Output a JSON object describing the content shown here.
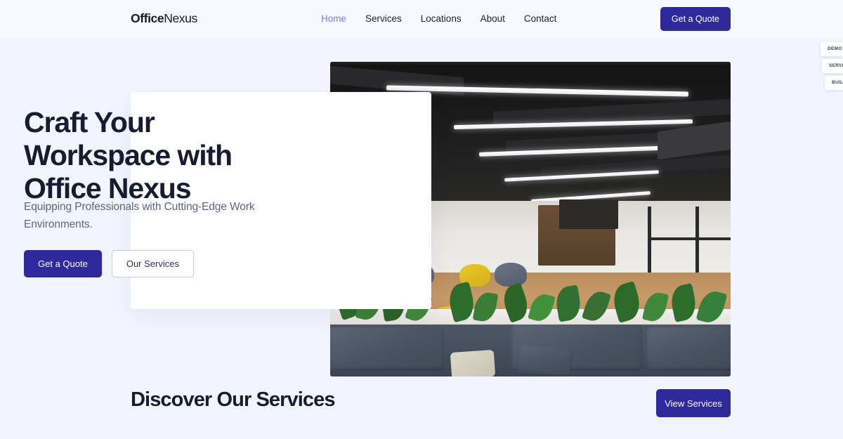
{
  "header": {
    "logo_bold": "Office",
    "logo_light": "Nexus",
    "nav": [
      {
        "label": "Home",
        "active": true
      },
      {
        "label": "Services",
        "active": false
      },
      {
        "label": "Locations",
        "active": false
      },
      {
        "label": "About",
        "active": false
      },
      {
        "label": "Contact",
        "active": false
      }
    ],
    "cta_label": "Get a Quote"
  },
  "edge_panel": {
    "chips": [
      {
        "label": "DEMO"
      },
      {
        "label": "SERVICES"
      },
      {
        "label": "BUILD"
      }
    ]
  },
  "hero": {
    "title": "Craft Your Workspace with Office Nexus",
    "subtitle": "Equipping Professionals with Cutting-Edge Work Environments.",
    "primary_cta": "Get a Quote",
    "secondary_cta": "Our Services",
    "photo_alt": "Modern open-plan office lounge with industrial dark ceiling, linear pendant lights, gray sofas, green plants and yellow bean bags"
  },
  "services_section": {
    "title": "Discover Our Services",
    "cta_label": "View Services"
  },
  "colors": {
    "page_background": "#f2f5fd",
    "header_background": "#f7f9fe",
    "accent_indigo": "#2e2a9e",
    "active_nav": "#7b7ff0",
    "heading_navy": "#171c30",
    "body_slate": "#5d6585",
    "card_white": "#ffffff",
    "outline_border": "#c9c9e4"
  }
}
